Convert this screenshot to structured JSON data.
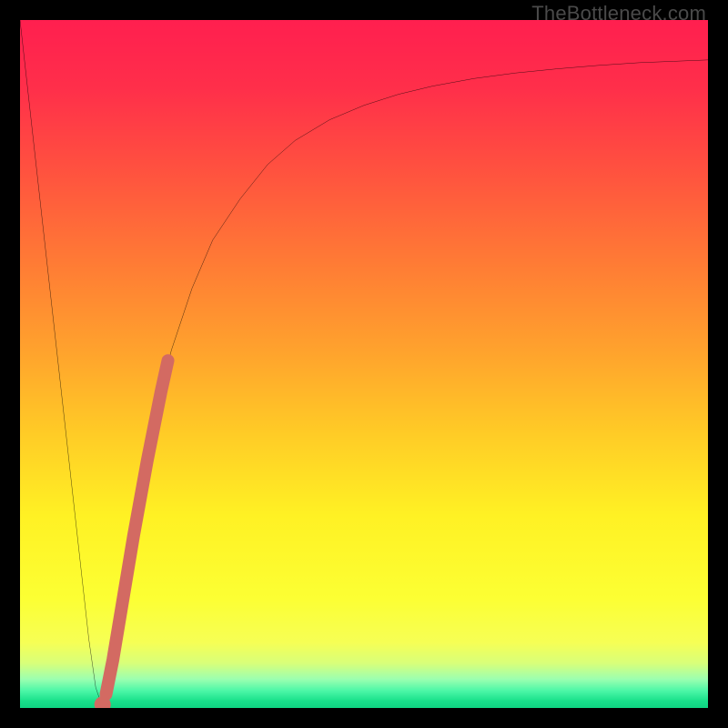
{
  "watermark": "TheBottleneck.com",
  "chart_data": {
    "type": "line",
    "title": "",
    "xlabel": "",
    "ylabel": "",
    "xlim": [
      0,
      100
    ],
    "ylim": [
      0,
      100
    ],
    "series": [
      {
        "name": "bottleneck-curve",
        "x": [
          0,
          2,
          4,
          6,
          8,
          10,
          11,
          12,
          13,
          14,
          16,
          18,
          20,
          22,
          25,
          28,
          32,
          36,
          40,
          45,
          50,
          55,
          60,
          66,
          72,
          78,
          84,
          90,
          95,
          100
        ],
        "y": [
          100,
          82,
          64,
          46,
          28,
          10,
          3,
          0,
          3,
          10,
          22,
          34,
          44,
          52,
          61,
          68,
          74,
          79,
          82.5,
          85.5,
          87.6,
          89.2,
          90.4,
          91.5,
          92.3,
          92.9,
          93.4,
          93.8,
          94.0,
          94.2
        ],
        "stroke": "#000000",
        "stroke_width": 2
      },
      {
        "name": "highlight-segment",
        "x": [
          12.5,
          13.5,
          14.5,
          15.5,
          16.5,
          17.5,
          18.5,
          19.5,
          20.5,
          21.5
        ],
        "y": [
          2,
          7,
          13,
          19,
          25,
          30.5,
          36,
          41,
          46,
          50.5
        ],
        "stroke": "#d36a62",
        "stroke_width": 14,
        "linecap": "round"
      },
      {
        "name": "min-marker",
        "x": [
          12.0
        ],
        "y": [
          0.5
        ],
        "marker": "circle",
        "color": "#d36a62",
        "size": 16
      }
    ],
    "background_gradient_stops": [
      {
        "pos": 0.0,
        "color": "#ff1f4f"
      },
      {
        "pos": 0.1,
        "color": "#ff2f4a"
      },
      {
        "pos": 0.22,
        "color": "#ff523f"
      },
      {
        "pos": 0.35,
        "color": "#ff7a35"
      },
      {
        "pos": 0.48,
        "color": "#ffa22d"
      },
      {
        "pos": 0.6,
        "color": "#ffcb26"
      },
      {
        "pos": 0.72,
        "color": "#fff124"
      },
      {
        "pos": 0.84,
        "color": "#fcff33"
      },
      {
        "pos": 0.905,
        "color": "#f6ff55"
      },
      {
        "pos": 0.935,
        "color": "#d8ff7a"
      },
      {
        "pos": 0.958,
        "color": "#9cffb0"
      },
      {
        "pos": 0.975,
        "color": "#4cf7a7"
      },
      {
        "pos": 0.99,
        "color": "#18e08a"
      },
      {
        "pos": 1.0,
        "color": "#0fd482"
      }
    ]
  }
}
